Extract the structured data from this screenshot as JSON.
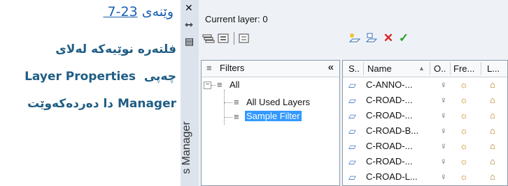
{
  "caption": {
    "figure_prefix": "وێنەی",
    "figure_number": "23-7",
    "line1": "فلتەرە نوێیەکە لەلای",
    "line2_word": "چەپی",
    "line2_latin": "Layer Properties",
    "line3_latin": "Manager",
    "line3_tail": "دا دەردەکەوێت"
  },
  "palette": {
    "title_side_text": "s Manager",
    "close_glyph": "✕",
    "pin_glyph": "⇿",
    "menu_glyph": "▤"
  },
  "toolbar": {
    "current_layer": "Current layer: 0"
  },
  "filters": {
    "header": "Filters",
    "collapse_glyph": "«",
    "tree": {
      "root": "All",
      "children": [
        "All Used Layers",
        "Sample Filter"
      ]
    }
  },
  "grid": {
    "columns": [
      "S..",
      "Name",
      "O..",
      "Fre...",
      "L..."
    ],
    "rows": [
      {
        "name": "C-ANNO-..."
      },
      {
        "name": "C-ROAD-..."
      },
      {
        "name": "C-ROAD-..."
      },
      {
        "name": "C-ROAD-B..."
      },
      {
        "name": "C-ROAD-..."
      },
      {
        "name": "C-ROAD-..."
      },
      {
        "name": "C-ROAD-L..."
      }
    ]
  },
  "colors": {
    "caption_blue": "#1f5d84",
    "link_blue": "#1a5fb4",
    "selection": "#3399ff"
  }
}
